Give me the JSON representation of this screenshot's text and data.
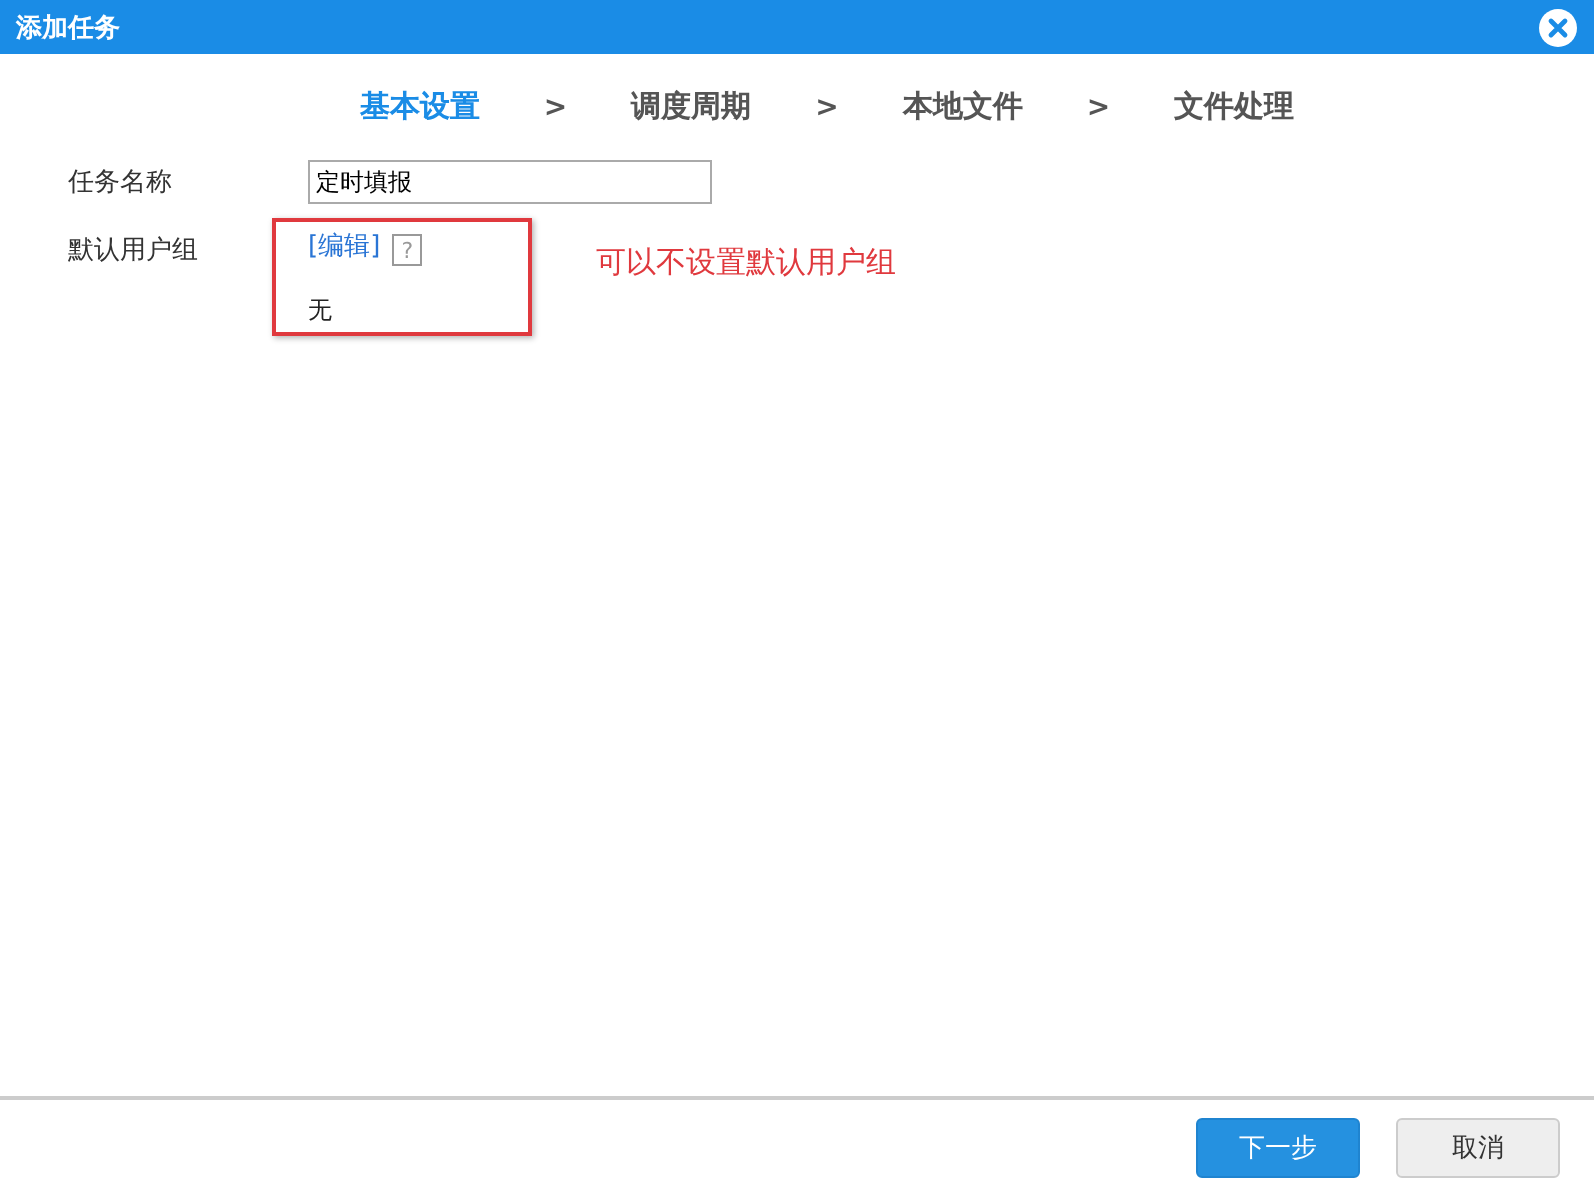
{
  "window": {
    "title": "添加任务"
  },
  "steps": [
    {
      "label": "基本设置",
      "selected": true
    },
    {
      "label": "调度周期",
      "selected": false
    },
    {
      "label": "本地文件",
      "selected": false
    },
    {
      "label": "文件处理",
      "selected": false
    }
  ],
  "step_separator": ">",
  "form": {
    "task_name": {
      "label": "任务名称",
      "value": "定时填报"
    },
    "user_group": {
      "label": "默认用户组",
      "edit_link": "[编辑]",
      "help": "?",
      "value": "无"
    }
  },
  "annotation": "可以不设置默认用户组",
  "buttons": [
    {
      "label": "下一步",
      "kind": "primary"
    },
    {
      "label": "取消",
      "kind": "secondary"
    }
  ]
}
